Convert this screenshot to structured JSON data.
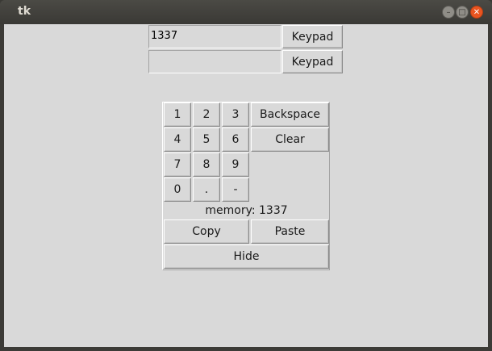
{
  "window": {
    "title": "tk",
    "minimize_icon": "minimize-icon",
    "maximize_icon": "maximize-icon",
    "close_icon": "close-icon",
    "close_color": "#e95420"
  },
  "entries": [
    {
      "value": "1337",
      "button_label": "Keypad"
    },
    {
      "value": "",
      "button_label": "Keypad"
    }
  ],
  "keypad": {
    "keys": [
      "1",
      "2",
      "3",
      "4",
      "5",
      "6",
      "7",
      "8",
      "9",
      "0",
      ".",
      "-"
    ],
    "backspace_label": "Backspace",
    "clear_label": "Clear",
    "memory_text": "memory: 1337",
    "copy_label": "Copy",
    "paste_label": "Paste",
    "hide_label": "Hide"
  }
}
